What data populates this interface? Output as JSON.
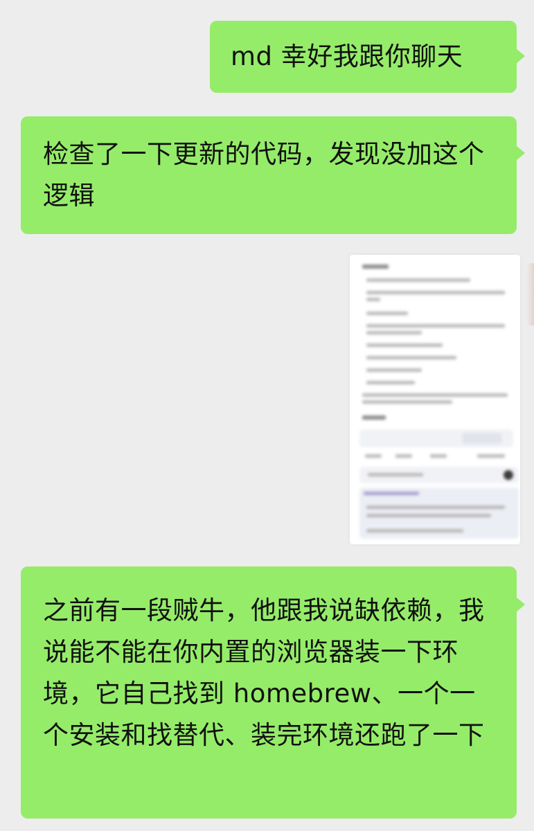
{
  "messages": [
    {
      "sender": "me",
      "type": "text",
      "text": "md 幸好我跟你聊天"
    },
    {
      "sender": "me",
      "type": "text",
      "text": "检查了一下更新的代码，发现没加这个逻辑"
    },
    {
      "sender": "me",
      "type": "image",
      "description": "blurred-screenshot"
    },
    {
      "sender": "me",
      "type": "text",
      "text": "之前有一段贼牛，他跟我说缺依赖，我说能不能在你内置的浏览器装一下环境，它自己找到 homebrew、一个一个安装和找替代、装完环境还跑了一下"
    }
  ],
  "colors": {
    "background": "#ededed",
    "sent_bubble": "#95ec69",
    "text": "#111111"
  }
}
